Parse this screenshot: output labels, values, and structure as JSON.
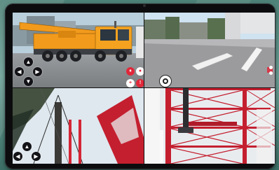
{
  "app": {
    "quadrants": [
      "crane-view",
      "slab-view",
      "tree-crane-view",
      "tower-view"
    ]
  },
  "colors": {
    "accent_red": "#e0283a",
    "crane_orange": "#f19a1c",
    "sky": "#cfe3f0",
    "control_dark": "#131317"
  },
  "controls": {
    "nav_icons": [
      "arrow-up-icon",
      "arrow-left-icon",
      "arrow-right-icon",
      "arrow-down-icon"
    ],
    "toolbar_icons": [
      "pin-icon",
      "info-icon",
      "add-icon",
      "warning-icon",
      "target-icon"
    ]
  }
}
